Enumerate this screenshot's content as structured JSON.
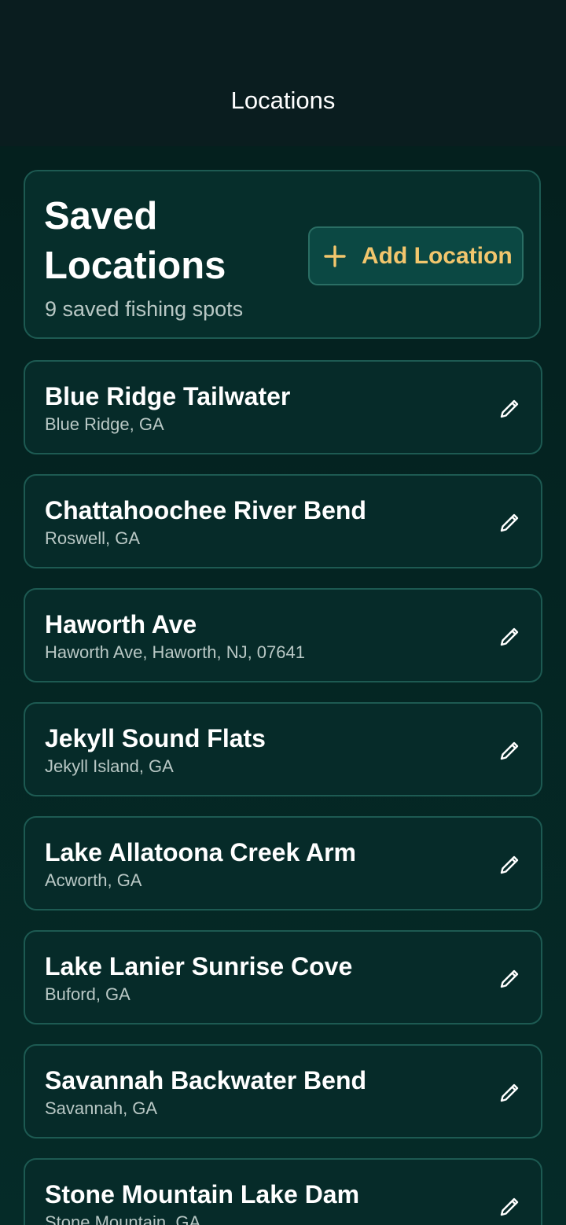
{
  "nav": {
    "title": "Locations"
  },
  "header": {
    "title": "Saved Locations",
    "subtitle": "9 saved fishing spots",
    "add_button_label": "Add Location",
    "add_icon": "plus-icon"
  },
  "colors": {
    "background": "#03211f",
    "card": "#062b29",
    "border": "#1d5a52",
    "accent": "#f2c66d",
    "subtext": "#b9c8c5"
  },
  "locations": [
    {
      "name": "Blue Ridge Tailwater",
      "address": "Blue Ridge, GA",
      "icon": "pencil-icon"
    },
    {
      "name": "Chattahoochee River Bend",
      "address": "Roswell, GA",
      "icon": "pencil-icon"
    },
    {
      "name": "Haworth Ave",
      "address": "Haworth Ave, Haworth, NJ, 07641",
      "icon": "pencil-icon"
    },
    {
      "name": "Jekyll Sound Flats",
      "address": "Jekyll Island, GA",
      "icon": "pencil-icon"
    },
    {
      "name": "Lake Allatoona Creek Arm",
      "address": "Acworth, GA",
      "icon": "pencil-icon"
    },
    {
      "name": "Lake Lanier Sunrise Cove",
      "address": "Buford, GA",
      "icon": "pencil-icon"
    },
    {
      "name": "Savannah Backwater Bend",
      "address": "Savannah, GA",
      "icon": "pencil-icon"
    },
    {
      "name": "Stone Mountain Lake Dam",
      "address": "Stone Mountain, GA",
      "icon": "pencil-icon"
    }
  ]
}
